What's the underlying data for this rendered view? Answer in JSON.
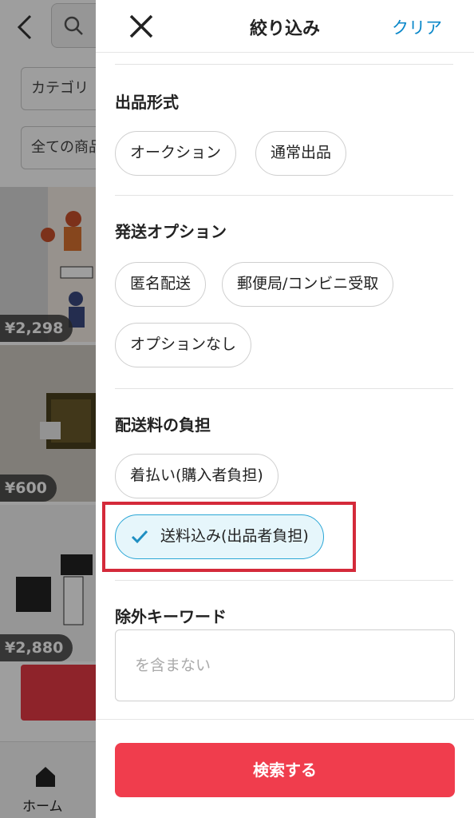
{
  "background": {
    "filter_chips": [
      "カテゴリ",
      "全ての商品"
    ],
    "prices": [
      "¥2,298",
      "¥600",
      "¥2,880"
    ],
    "nav_label": "ホーム"
  },
  "header": {
    "title": "絞り込み",
    "clear_label": "クリア"
  },
  "sections": {
    "listing_format": {
      "title": "出品形式",
      "options": [
        "オークション",
        "通常出品"
      ]
    },
    "shipping_options": {
      "title": "発送オプション",
      "options": [
        "匿名配送",
        "郵便局/コンビニ受取",
        "オプションなし"
      ]
    },
    "shipping_fee": {
      "title": "配送料の負担",
      "options": [
        "着払い(購入者負担)",
        "送料込み(出品者負担)"
      ],
      "selected": "送料込み(出品者負担)"
    },
    "exclude_keywords": {
      "title": "除外キーワード",
      "placeholder": "を含まない",
      "value": ""
    }
  },
  "footer": {
    "search_label": "検索する"
  },
  "colors": {
    "accent_blue": "#0a87c9",
    "selected_bg": "#e6f6fb",
    "primary_red": "#f03d4d",
    "highlight_red": "#d42a3a"
  }
}
